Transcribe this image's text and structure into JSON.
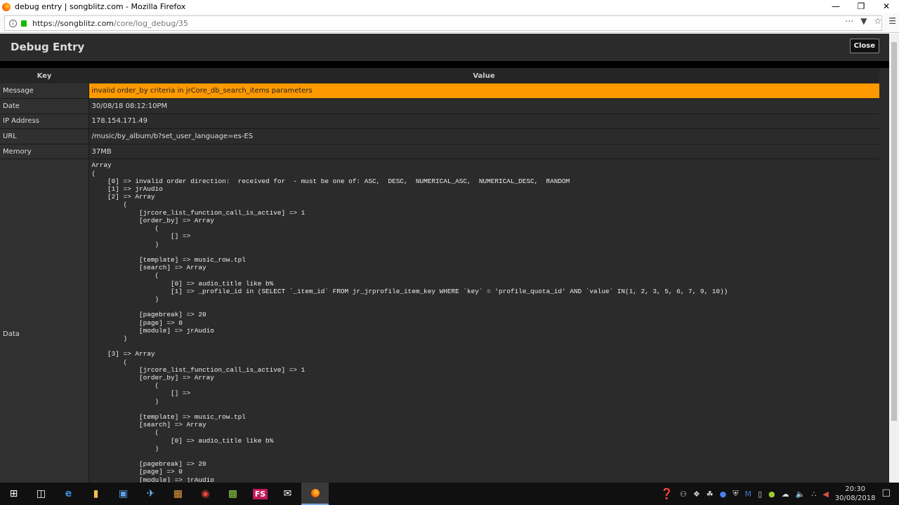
{
  "window": {
    "title": "debug entry | songblitz.com - Mozilla Firefox"
  },
  "url": {
    "host": "https://songblitz.com",
    "path": "/core/log_debug/35"
  },
  "header": {
    "title": "Debug Entry",
    "close_label": "Close"
  },
  "table": {
    "columns": [
      "Key",
      "Value"
    ],
    "rows": [
      {
        "key": "Message",
        "value": "invalid order_by criteria in jrCore_db_search_items parameters"
      },
      {
        "key": "Date",
        "value": "30/08/18 08:12:10PM"
      },
      {
        "key": "IP Address",
        "value": "178.154.171.49"
      },
      {
        "key": "URL",
        "value": "/music/by_album/b?set_user_language=es-ES"
      },
      {
        "key": "Memory",
        "value": "37MB"
      }
    ],
    "data_key": "Data",
    "data_value": "Array\n(\n    [0] => invalid order direction:  received for  - must be one of: ASC,  DESC,  NUMERICAL_ASC,  NUMERICAL_DESC,  RANDOM\n    [1] => jrAudio\n    [2] => Array\n        (\n            [jrcore_list_function_call_is_active] => 1\n            [order_by] => Array\n                (\n                    [] => \n                )\n\n            [template] => music_row.tpl\n            [search] => Array\n                (\n                    [0] => audio_title like b%\n                    [1] => _profile_id in (SELECT `_item_id` FROM jr_jrprofile_item_key WHERE `key` = 'profile_quota_id' AND `value` IN(1, 2, 3, 5, 6, 7, 9, 10))\n                )\n\n            [pagebreak] => 20\n            [page] => 0\n            [module] => jrAudio\n        )\n\n    [3] => Array\n        (\n            [jrcore_list_function_call_is_active] => 1\n            [order_by] => Array\n                (\n                    [] => \n                )\n\n            [template] => music_row.tpl\n            [search] => Array\n                (\n                    [0] => audio_title like b%\n                )\n\n            [pagebreak] => 20\n            [page] => 0\n            [module] => jrAudio"
  },
  "taskbar": {
    "time": "20:30",
    "date": "30/08/2018",
    "fs_label": "FS"
  }
}
